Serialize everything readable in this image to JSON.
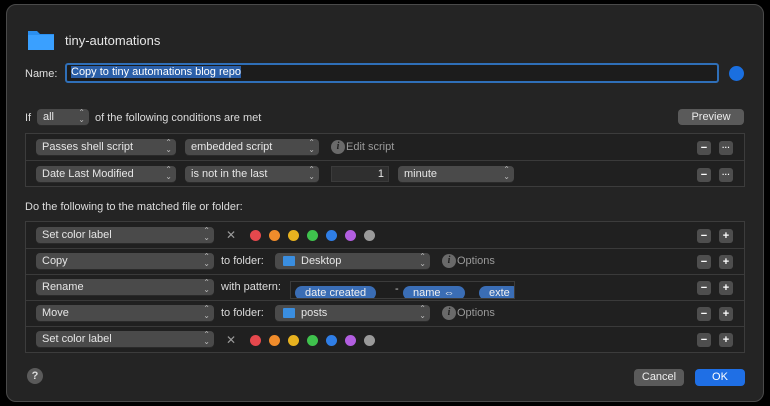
{
  "header": {
    "folder_name": "tiny-automations",
    "name_label": "Name:",
    "name_value": "Copy to tiny automations blog repo"
  },
  "conditions": {
    "if_label": "If",
    "match_value": "all",
    "of_label": "of the following conditions are met",
    "preview_label": "Preview",
    "rows": [
      {
        "attribute": "Passes shell script",
        "operator": "embedded script",
        "action_label": "Edit script"
      },
      {
        "attribute": "Date Last Modified",
        "operator": "is not in the last",
        "amount": "1",
        "unit": "minute"
      }
    ]
  },
  "actions": {
    "heading": "Do the following to the matched file or folder:",
    "rows": [
      {
        "action": "Set color label"
      },
      {
        "action": "Copy",
        "to_label": "to folder:",
        "folder": "Desktop",
        "options_label": "Options"
      },
      {
        "action": "Rename",
        "pattern_label": "with pattern:",
        "tokens": [
          "date created",
          "-",
          "name ⇔",
          "exte"
        ]
      },
      {
        "action": "Move",
        "to_label": "to folder:",
        "folder": "posts",
        "options_label": "Options"
      },
      {
        "action": "Set color label"
      }
    ],
    "color_dots": [
      "#e5484d",
      "#f08c2b",
      "#e8b21f",
      "#3fc24d",
      "#2f7ee6",
      "#b25ee0",
      "#9a9a9a"
    ]
  },
  "footer": {
    "help": "?",
    "cancel_label": "Cancel",
    "ok_label": "OK"
  },
  "glyphs": {
    "minus": "−",
    "plus": "+",
    "more": "···",
    "info": "i",
    "x": "✕",
    "chevron": "⌃⌄"
  }
}
